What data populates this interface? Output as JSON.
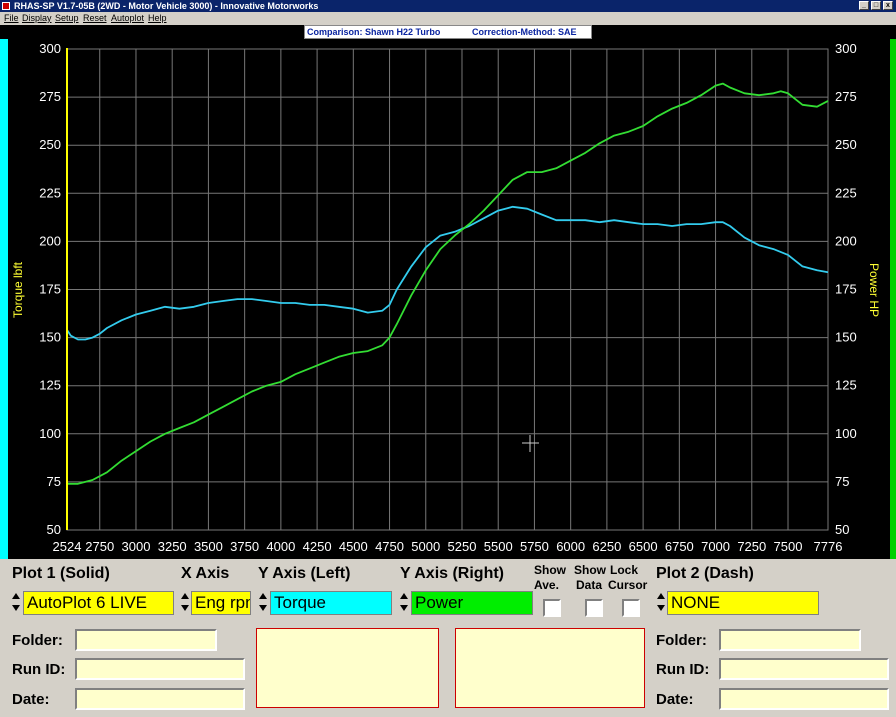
{
  "window": {
    "title": "RHAS-SP V1.7-05B  (2WD - Motor Vehicle 3000) - Innovative Motorworks"
  },
  "menu": [
    "File",
    "Display",
    "Setup",
    "Reset",
    "Autoplot",
    "Help"
  ],
  "banner": {
    "comparison": "Comparison: Shawn H22 Turbo",
    "correction": "Correction-Method: SAE"
  },
  "chart_data": {
    "type": "line",
    "ylabel_left": "Torque lbft",
    "ylabel_right": "Power HP",
    "xlim": [
      2524,
      7776
    ],
    "ylim": [
      50,
      300
    ],
    "x_ticks": [
      "2524",
      "2750",
      "3000",
      "3250",
      "3500",
      "3750",
      "4000",
      "4250",
      "4500",
      "4750",
      "5000",
      "5250",
      "5500",
      "5750",
      "6000",
      "6250",
      "6500",
      "6750",
      "7000",
      "7250",
      "7500",
      "7776"
    ],
    "y_ticks": [
      "50",
      "75",
      "100",
      "125",
      "150",
      "175",
      "200",
      "225",
      "250",
      "275",
      "300"
    ],
    "grid": true,
    "colors": {
      "torque": "#33ccee",
      "power": "#33dd33",
      "cursor": "#ffff00",
      "axis_text": "#ffffff"
    },
    "series": [
      {
        "name": "Torque",
        "color": "#33ccee",
        "x": [
          2524,
          2550,
          2600,
          2650,
          2700,
          2750,
          2800,
          2900,
          3000,
          3100,
          3200,
          3300,
          3400,
          3500,
          3600,
          3700,
          3800,
          3900,
          4000,
          4100,
          4200,
          4300,
          4400,
          4500,
          4600,
          4700,
          4750,
          4800,
          4900,
          5000,
          5100,
          5200,
          5300,
          5400,
          5500,
          5600,
          5700,
          5800,
          5900,
          6000,
          6100,
          6200,
          6300,
          6400,
          6500,
          6600,
          6700,
          6800,
          6900,
          7000,
          7050,
          7100,
          7200,
          7300,
          7400,
          7500,
          7600,
          7700,
          7776
        ],
        "values": [
          154,
          151,
          149,
          149,
          150,
          152,
          155,
          159,
          162,
          164,
          166,
          165,
          166,
          168,
          169,
          170,
          170,
          169,
          168,
          168,
          167,
          167,
          166,
          165,
          163,
          164,
          167,
          175,
          187,
          197,
          203,
          205,
          208,
          212,
          216,
          218,
          217,
          214,
          211,
          211,
          211,
          210,
          211,
          210,
          209,
          209,
          208,
          209,
          209,
          210,
          210,
          208,
          202,
          198,
          196,
          193,
          187,
          185,
          184
        ]
      },
      {
        "name": "Power",
        "color": "#33dd33",
        "x": [
          2524,
          2600,
          2700,
          2800,
          2900,
          3000,
          3100,
          3200,
          3300,
          3400,
          3500,
          3600,
          3700,
          3800,
          3900,
          4000,
          4100,
          4200,
          4300,
          4400,
          4500,
          4600,
          4700,
          4750,
          4800,
          4900,
          5000,
          5100,
          5200,
          5300,
          5400,
          5500,
          5600,
          5700,
          5800,
          5900,
          6000,
          6100,
          6200,
          6300,
          6400,
          6500,
          6600,
          6700,
          6800,
          6900,
          7000,
          7050,
          7100,
          7200,
          7300,
          7400,
          7450,
          7500,
          7600,
          7700,
          7776
        ],
        "values": [
          74,
          74,
          76,
          80,
          86,
          91,
          96,
          100,
          103,
          106,
          110,
          114,
          118,
          122,
          125,
          127,
          131,
          134,
          137,
          140,
          142,
          143,
          146,
          150,
          157,
          172,
          185,
          196,
          203,
          209,
          216,
          224,
          232,
          236,
          236,
          238,
          242,
          246,
          251,
          255,
          257,
          260,
          265,
          269,
          272,
          276,
          281,
          282,
          280,
          277,
          276,
          277,
          278,
          277,
          271,
          270,
          273
        ]
      }
    ]
  },
  "controls": {
    "plot1_label": "Plot 1 (Solid)",
    "xaxis_label": "X Axis",
    "yleft_label": "Y Axis (Left)",
    "yright_label": "Y Axis (Right)",
    "show_ave_line1": "Show",
    "show_ave_line2": "Ave.",
    "show_data_line1": "Show",
    "show_data_line2": "Data",
    "lock_cursor_line1": "Lock",
    "lock_cursor_line2": "Cursor",
    "plot2_label": "Plot 2 (Dash)",
    "plot1_value": "AutoPlot 6 LIVE",
    "xaxis_value": "Eng rpm",
    "yleft_value": "Torque",
    "yright_value": "Power",
    "plot2_value": "NONE",
    "folder_label": "Folder:",
    "runid_label": "Run ID:",
    "date_label": "Date:",
    "colors": {
      "plot1": "#ffff00",
      "xaxis": "#ffff00",
      "yleft": "#00ffff",
      "yright": "#00ee00",
      "plot2": "#ffff00"
    }
  }
}
